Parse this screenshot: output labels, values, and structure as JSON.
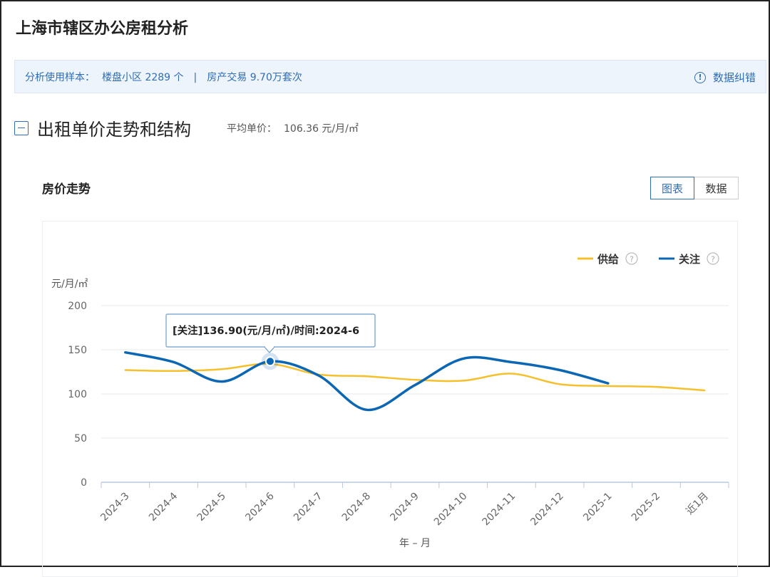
{
  "page": {
    "title": "上海市辖区办公房租分析"
  },
  "sample": {
    "label": "分析使用样本：",
    "item1": "楼盘小区 2289 个",
    "separator": "|",
    "item2": "房产交易 9.70万套次",
    "correct_label": "数据纠错",
    "correct_icon": "info-icon"
  },
  "section": {
    "title": "出租单价走势和结构",
    "avg_label": "平均单价：",
    "avg_value": "106.36 元/月/㎡",
    "collapse_icon": "minus-square-icon"
  },
  "chart_panel": {
    "title": "房价走势",
    "tabs": [
      "图表",
      "数据"
    ],
    "active_tab": "图表"
  },
  "chart_data": {
    "type": "line",
    "ylabel": "元/月/㎡",
    "xlabel": "年 – 月",
    "ylim": [
      0,
      200
    ],
    "yticks": [
      "0",
      "50",
      "100",
      "150",
      "200"
    ],
    "categories": [
      "2024-3",
      "2024-4",
      "2024-5",
      "2024-6",
      "2024-7",
      "2024-8",
      "2024-9",
      "2024-10",
      "2024-11",
      "2024-12",
      "2025-1",
      "2025-2",
      "近1月"
    ],
    "legend_position": "top-right",
    "grid": true,
    "series": [
      {
        "name": "供给",
        "color": "#f5c02b",
        "values": [
          127,
          126,
          128,
          134,
          122,
          120,
          116,
          115,
          123,
          111,
          109,
          108,
          104
        ]
      },
      {
        "name": "关注",
        "color": "#0b66b3",
        "values": [
          147,
          136,
          114,
          136.9,
          121,
          82,
          110,
          140,
          136,
          127,
          112,
          null,
          null
        ]
      }
    ],
    "tooltip": {
      "text": "[关注]136.90(元/月/㎡)/时间:2024-6",
      "series": "关注",
      "category": "2024-6",
      "value": 136.9
    }
  }
}
